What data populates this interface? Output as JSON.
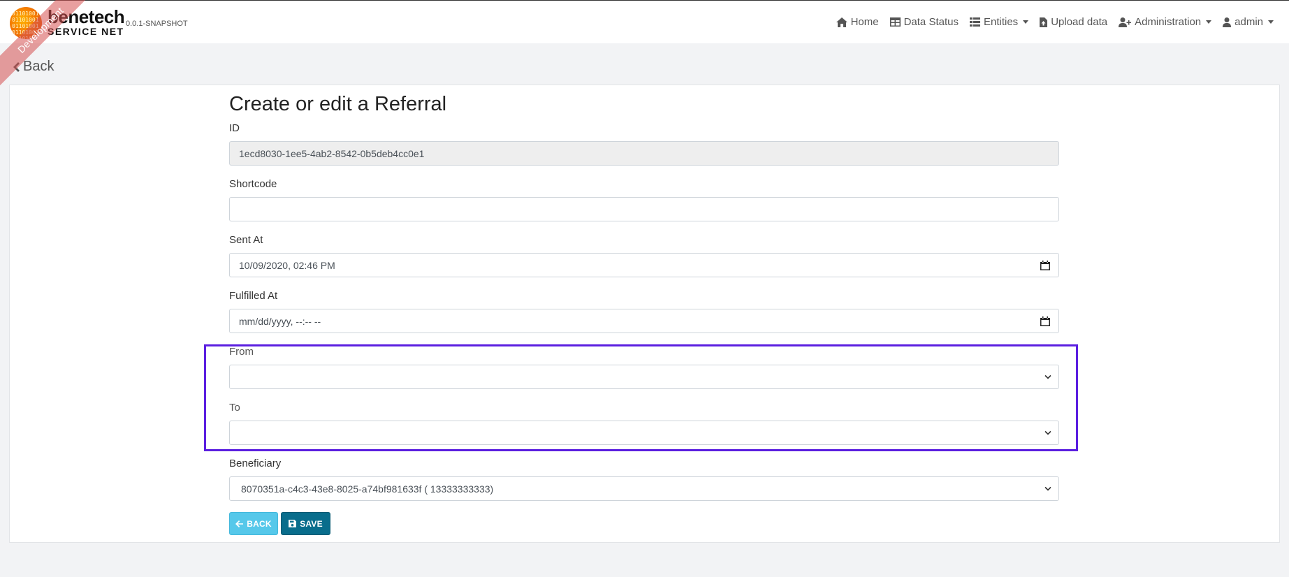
{
  "brand": {
    "name": "benetech",
    "subtitle": "SERVICE NET",
    "version": "0.0.1-SNAPSHOT",
    "ribbon": "Development",
    "logo_digits": "0110100101101001011010010110100101101001"
  },
  "nav": {
    "home": "Home",
    "data_status": "Data Status",
    "entities": "Entities",
    "upload": "Upload data",
    "administration": "Administration",
    "account": "admin"
  },
  "back_link": "Back",
  "form": {
    "title": "Create or edit a Referral",
    "id_label": "ID",
    "id_value": "1ecd8030-1ee5-4ab2-8542-0b5deb4cc0e1",
    "shortcode_label": "Shortcode",
    "shortcode_value": "",
    "sent_at_label": "Sent At",
    "sent_at_value": "10/09/2020, 02:46 PM",
    "fulfilled_at_label": "Fulfilled At",
    "fulfilled_at_value": "mm/dd/yyyy, --:-- --",
    "from_label": "From",
    "from_value": "",
    "to_label": "To",
    "to_value": "",
    "beneficiary_label": "Beneficiary",
    "beneficiary_value": "8070351a-c4c3-43e8-8025-a74bf981633f ( 13333333333)"
  },
  "buttons": {
    "back": "BACK",
    "save": "SAVE"
  },
  "colors": {
    "highlight": "#5b1fe0",
    "back_button": "#56c8ea",
    "save_button": "#096d8c"
  }
}
